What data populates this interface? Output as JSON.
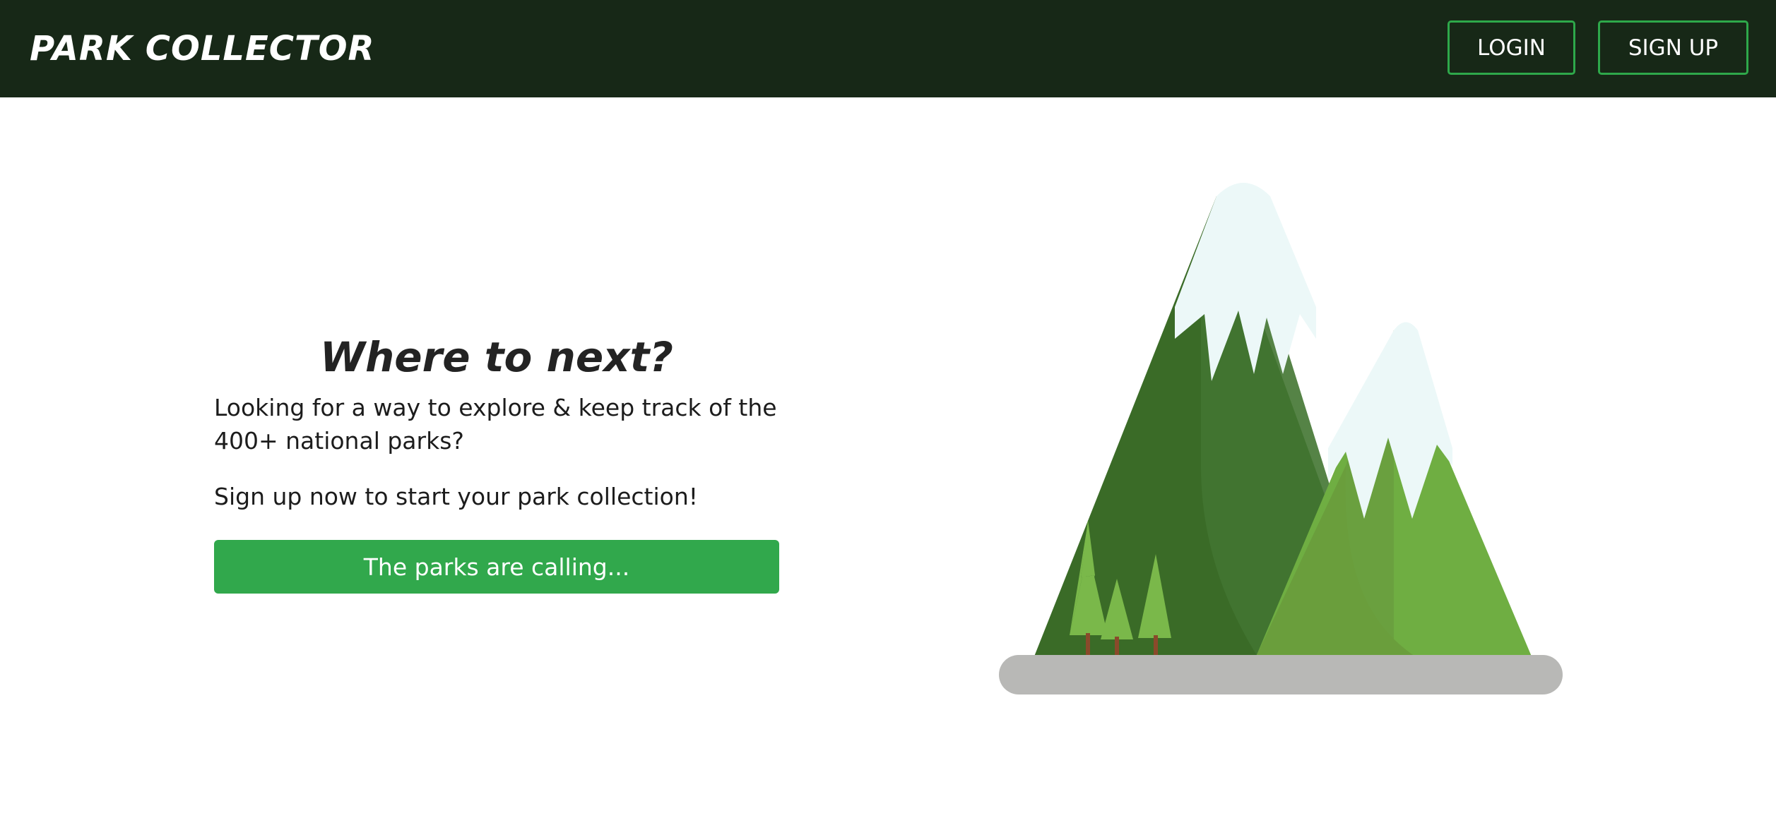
{
  "header": {
    "brand": "Park Collector",
    "login_label": "LOGIN",
    "signup_label": "SIGN UP"
  },
  "hero": {
    "title": "Where to next?",
    "text_1": "Looking for a way to explore & keep track of the 400+ national parks?",
    "text_2": "Sign up now to start your park collection!",
    "cta_label": "The parks are calling..."
  },
  "colors": {
    "navbar_bg": "#172817",
    "accent_green": "#31a84c",
    "dark_mountain": "#3a6b27",
    "light_mountain": "#6fae42",
    "snow": "#ecf8f8",
    "ground": "#b8b8b6"
  },
  "icons": {
    "illustration": "mountains-illustration"
  }
}
